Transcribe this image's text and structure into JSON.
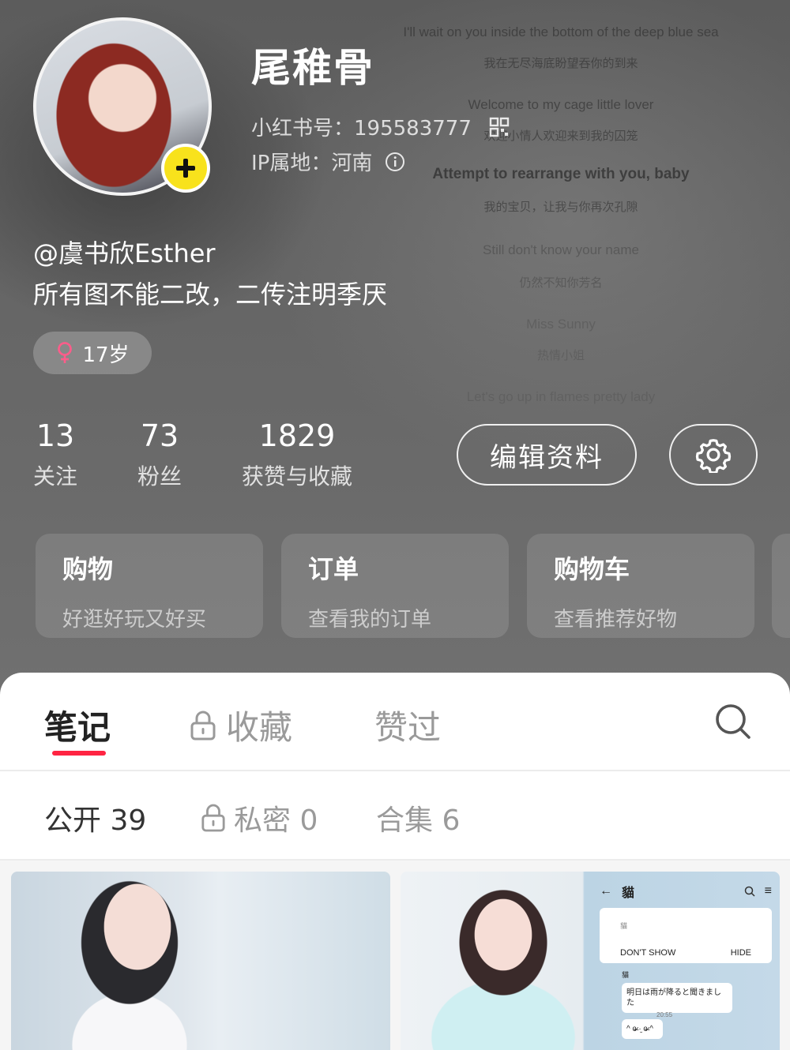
{
  "background_lyrics": [
    {
      "text": "I'll wait on you inside the bottom of the deep blue sea",
      "style": "en"
    },
    {
      "text": "我在无尽海底盼望吞你的到来",
      "style": "cn"
    },
    {
      "text": "Welcome to my cage little lover",
      "style": "en"
    },
    {
      "text": "欢迎小情人欢迎来到我的囚笼",
      "style": "cn"
    },
    {
      "text": "Attempt to rearrange with you, baby",
      "style": "bold"
    },
    {
      "text": "我的宝贝，让我与你再次孔隙",
      "style": "cn"
    },
    {
      "text": "Still don't know your name",
      "style": "en"
    },
    {
      "text": "仍然不知你芳名",
      "style": "cn"
    },
    {
      "text": "Miss Sunny",
      "style": "en"
    },
    {
      "text": "热情小姐",
      "style": "cn"
    },
    {
      "text": "Let's go up in flames pretty lady",
      "style": "en"
    }
  ],
  "profile": {
    "nickname": "尾稚骨",
    "id_label": "小红书号：195583777",
    "ip_label": "IP属地：河南",
    "handle": "@虞书欣Esther",
    "bio": "所有图不能二改，二传注明季厌",
    "age": "17岁"
  },
  "stats": [
    {
      "value": "13",
      "label": "关注"
    },
    {
      "value": "73",
      "label": "粉丝"
    },
    {
      "value": "1829",
      "label": "获赞与收藏"
    }
  ],
  "actions": {
    "edit_label": "编辑资料"
  },
  "cards": [
    {
      "title": "购物",
      "subtitle": "好逛好玩又好买"
    },
    {
      "title": "订单",
      "subtitle": "查看我的订单"
    },
    {
      "title": "购物车",
      "subtitle": "查看推荐好物"
    }
  ],
  "tabs": [
    {
      "label": "笔记",
      "active": true,
      "locked": false
    },
    {
      "label": "收藏",
      "active": false,
      "locked": true
    },
    {
      "label": "赞过",
      "active": false,
      "locked": false
    }
  ],
  "subtabs": [
    {
      "label": "公开 39",
      "active": true,
      "locked": false
    },
    {
      "label": "私密 0",
      "active": false,
      "locked": true
    },
    {
      "label": "合集 6",
      "active": false,
      "locked": false
    }
  ],
  "chat_preview": {
    "title": "貓",
    "card_title": "貓",
    "dont_show": "DON'T SHOW",
    "hide": "HIDE",
    "sender": "貓",
    "message": "明日は雨が降ると聞きました",
    "reply": "^ ɞ̴̶̷ ·̮ ɞ̴̶̷ ^",
    "time": "20:55"
  },
  "colors": {
    "accent": "#ff2442",
    "add_button": "#f8e21c"
  },
  "icons": [
    "plus-icon",
    "qr-code-icon",
    "info-icon",
    "female-icon",
    "gear-icon",
    "lock-icon",
    "search-icon",
    "back-arrow-icon",
    "menu-icon"
  ]
}
